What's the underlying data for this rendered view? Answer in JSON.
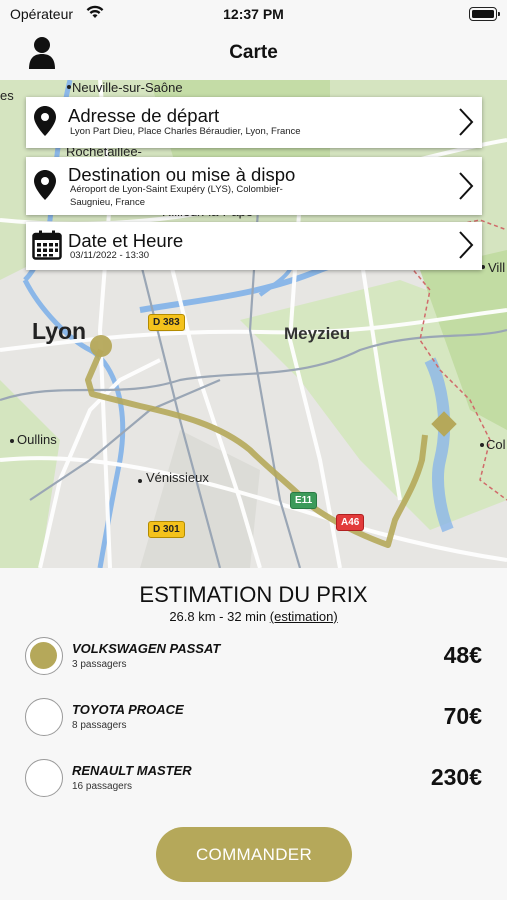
{
  "status_bar": {
    "carrier": "Opérateur",
    "time": "12:37 PM"
  },
  "nav": {
    "title": "Carte",
    "profile_icon": "user-icon"
  },
  "map": {
    "labels": {
      "es": "es",
      "neuville": "Neuville-sur-Saône",
      "rochetaillee": "Rochetaillée-",
      "rillieux": "Rillieux-la-Pape",
      "ville": "Vill",
      "lyon": "Lyon",
      "meyzieu": "Meyzieu",
      "oullins": "Oullins",
      "venissieux": "Vénissieux",
      "col": "Col"
    },
    "road_badges": {
      "d383": "D 383",
      "d301": "D 301",
      "e11": "E11",
      "a46": "A46"
    },
    "route_color": "#b5a85a"
  },
  "departure": {
    "title": "Adresse de départ",
    "value": "Lyon Part Dieu, Place Charles Béraudier, Lyon, France",
    "icon": "map-pin-icon"
  },
  "destination": {
    "title": "Destination ou mise à dispo",
    "value_line1": "Aéroport de Lyon-Saint Exupéry (LYS), Colombier-",
    "value_line2": "Saugnieu, France",
    "icon": "map-pin-icon"
  },
  "datetime": {
    "title": "Date et Heure",
    "value": "03/11/2022 - 13:30",
    "icon": "calendar-icon"
  },
  "estimation": {
    "title": "ESTIMATION DU PRIX",
    "distance_time": "26.8 km - 32 min",
    "estimation_link": "(estimation)"
  },
  "vehicles": [
    {
      "name": "VOLKSWAGEN PASSAT",
      "seats": "3 passagers",
      "price": "48€",
      "selected": true
    },
    {
      "name": "TOYOTA PROACE",
      "seats": "8 passagers",
      "price": "70€",
      "selected": false
    },
    {
      "name": "RENAULT MASTER",
      "seats": "16 passagers",
      "price": "230€",
      "selected": false
    }
  ],
  "order_button": "COMMANDER",
  "colors": {
    "accent": "#b5a85a"
  }
}
